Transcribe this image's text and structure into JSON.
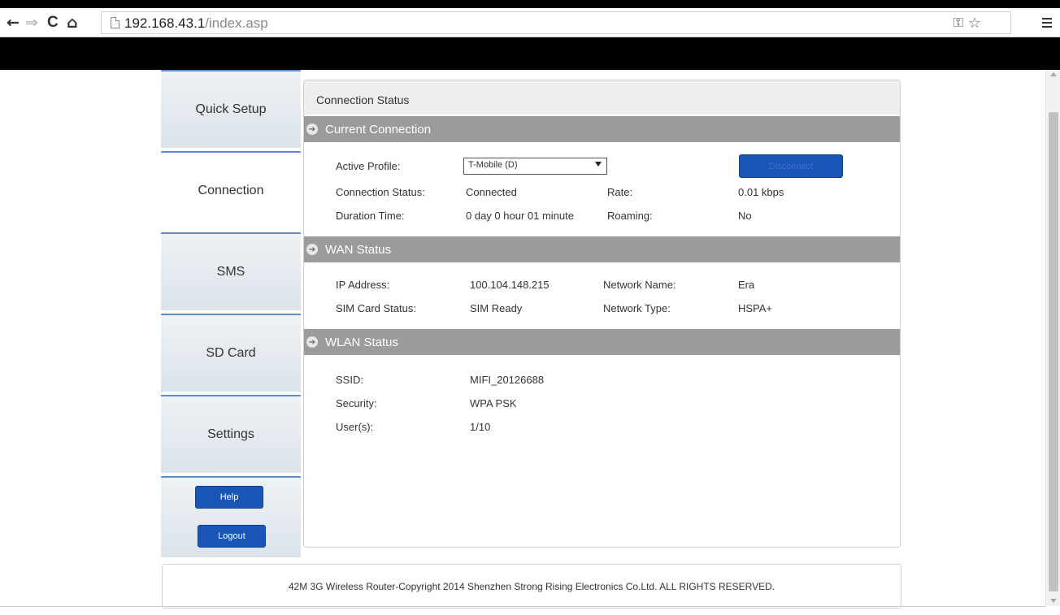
{
  "browser": {
    "back_glyph": "←",
    "forward_glyph": "⇒",
    "reload_glyph": "C",
    "home_glyph": "⌂",
    "url_host": "192.168.43.1",
    "url_path": "/index.asp",
    "key_glyph": "⚿",
    "star_glyph": "☆"
  },
  "sidebar": {
    "items": [
      {
        "label": "Quick Setup"
      },
      {
        "label": "Connection"
      },
      {
        "label": "SMS"
      },
      {
        "label": "SD Card"
      },
      {
        "label": "Settings"
      }
    ],
    "active_index": 1,
    "help_label": "Help",
    "logout_label": "Logout"
  },
  "panel": {
    "title": "Connection Status",
    "current_connection": {
      "heading": "Current Connection",
      "active_profile_label": "Active Profile:",
      "active_profile_value": "T-Mobile (D)",
      "disconnect_label": "Disconnect",
      "connection_status_label": "Connection Status:",
      "connection_status_value": "Connected",
      "rate_label": "Rate:",
      "rate_value": "0.01 kbps",
      "duration_label": "Duration Time:",
      "duration_value": "0 day 0 hour 01 minute",
      "roaming_label": "Roaming:",
      "roaming_value": "No"
    },
    "wan_status": {
      "heading": "WAN Status",
      "ip_label": "IP Address:",
      "ip_value": "100.104.148.215",
      "network_name_label": "Network Name:",
      "network_name_value": "Era",
      "sim_label": "SIM Card Status:",
      "sim_value": "SIM Ready",
      "network_type_label": "Network Type:",
      "network_type_value": "HSPA+"
    },
    "wlan_status": {
      "heading": "WLAN Status",
      "ssid_label": "SSID:",
      "ssid_value": "MIFI_20126688",
      "security_label": "Security:",
      "security_value": "WPA PSK",
      "users_label": "User(s):",
      "users_value": "1/10"
    }
  },
  "footer": {
    "text": "42M 3G Wireless Router-Copyright 2014 Shenzhen Strong Rising Electronics Co.Ltd. ALL RIGHTS RESERVED."
  },
  "colors": {
    "button_blue": "#1a56b8",
    "section_bar_gray": "#9b9b9b",
    "nav_border_blue": "#5a8fc9"
  }
}
